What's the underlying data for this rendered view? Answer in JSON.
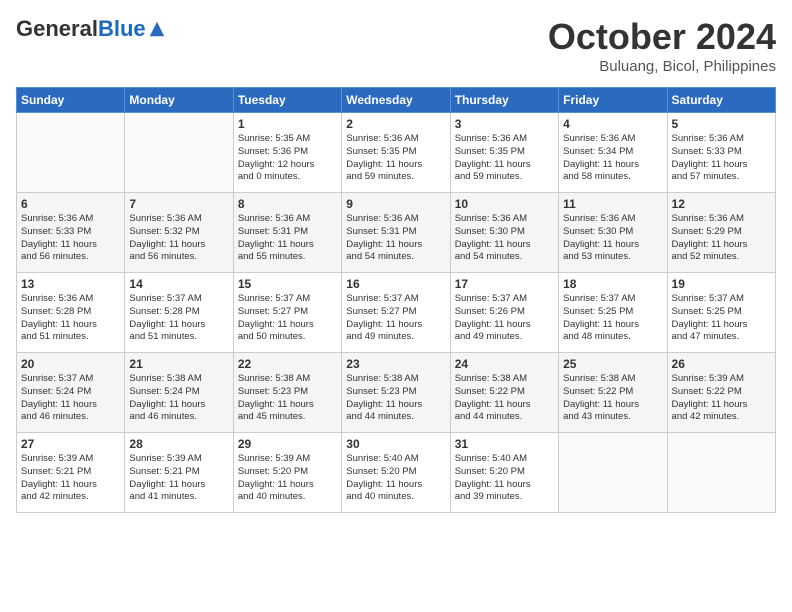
{
  "header": {
    "logo_general": "General",
    "logo_blue": "Blue",
    "month_title": "October 2024",
    "subtitle": "Buluang, Bicol, Philippines"
  },
  "days_of_week": [
    "Sunday",
    "Monday",
    "Tuesday",
    "Wednesday",
    "Thursday",
    "Friday",
    "Saturday"
  ],
  "weeks": [
    [
      {
        "day": "",
        "info": ""
      },
      {
        "day": "",
        "info": ""
      },
      {
        "day": "1",
        "info": "Sunrise: 5:35 AM\nSunset: 5:36 PM\nDaylight: 12 hours\nand 0 minutes."
      },
      {
        "day": "2",
        "info": "Sunrise: 5:36 AM\nSunset: 5:35 PM\nDaylight: 11 hours\nand 59 minutes."
      },
      {
        "day": "3",
        "info": "Sunrise: 5:36 AM\nSunset: 5:35 PM\nDaylight: 11 hours\nand 59 minutes."
      },
      {
        "day": "4",
        "info": "Sunrise: 5:36 AM\nSunset: 5:34 PM\nDaylight: 11 hours\nand 58 minutes."
      },
      {
        "day": "5",
        "info": "Sunrise: 5:36 AM\nSunset: 5:33 PM\nDaylight: 11 hours\nand 57 minutes."
      }
    ],
    [
      {
        "day": "6",
        "info": "Sunrise: 5:36 AM\nSunset: 5:33 PM\nDaylight: 11 hours\nand 56 minutes."
      },
      {
        "day": "7",
        "info": "Sunrise: 5:36 AM\nSunset: 5:32 PM\nDaylight: 11 hours\nand 56 minutes."
      },
      {
        "day": "8",
        "info": "Sunrise: 5:36 AM\nSunset: 5:31 PM\nDaylight: 11 hours\nand 55 minutes."
      },
      {
        "day": "9",
        "info": "Sunrise: 5:36 AM\nSunset: 5:31 PM\nDaylight: 11 hours\nand 54 minutes."
      },
      {
        "day": "10",
        "info": "Sunrise: 5:36 AM\nSunset: 5:30 PM\nDaylight: 11 hours\nand 54 minutes."
      },
      {
        "day": "11",
        "info": "Sunrise: 5:36 AM\nSunset: 5:30 PM\nDaylight: 11 hours\nand 53 minutes."
      },
      {
        "day": "12",
        "info": "Sunrise: 5:36 AM\nSunset: 5:29 PM\nDaylight: 11 hours\nand 52 minutes."
      }
    ],
    [
      {
        "day": "13",
        "info": "Sunrise: 5:36 AM\nSunset: 5:28 PM\nDaylight: 11 hours\nand 51 minutes."
      },
      {
        "day": "14",
        "info": "Sunrise: 5:37 AM\nSunset: 5:28 PM\nDaylight: 11 hours\nand 51 minutes."
      },
      {
        "day": "15",
        "info": "Sunrise: 5:37 AM\nSunset: 5:27 PM\nDaylight: 11 hours\nand 50 minutes."
      },
      {
        "day": "16",
        "info": "Sunrise: 5:37 AM\nSunset: 5:27 PM\nDaylight: 11 hours\nand 49 minutes."
      },
      {
        "day": "17",
        "info": "Sunrise: 5:37 AM\nSunset: 5:26 PM\nDaylight: 11 hours\nand 49 minutes."
      },
      {
        "day": "18",
        "info": "Sunrise: 5:37 AM\nSunset: 5:25 PM\nDaylight: 11 hours\nand 48 minutes."
      },
      {
        "day": "19",
        "info": "Sunrise: 5:37 AM\nSunset: 5:25 PM\nDaylight: 11 hours\nand 47 minutes."
      }
    ],
    [
      {
        "day": "20",
        "info": "Sunrise: 5:37 AM\nSunset: 5:24 PM\nDaylight: 11 hours\nand 46 minutes."
      },
      {
        "day": "21",
        "info": "Sunrise: 5:38 AM\nSunset: 5:24 PM\nDaylight: 11 hours\nand 46 minutes."
      },
      {
        "day": "22",
        "info": "Sunrise: 5:38 AM\nSunset: 5:23 PM\nDaylight: 11 hours\nand 45 minutes."
      },
      {
        "day": "23",
        "info": "Sunrise: 5:38 AM\nSunset: 5:23 PM\nDaylight: 11 hours\nand 44 minutes."
      },
      {
        "day": "24",
        "info": "Sunrise: 5:38 AM\nSunset: 5:22 PM\nDaylight: 11 hours\nand 44 minutes."
      },
      {
        "day": "25",
        "info": "Sunrise: 5:38 AM\nSunset: 5:22 PM\nDaylight: 11 hours\nand 43 minutes."
      },
      {
        "day": "26",
        "info": "Sunrise: 5:39 AM\nSunset: 5:22 PM\nDaylight: 11 hours\nand 42 minutes."
      }
    ],
    [
      {
        "day": "27",
        "info": "Sunrise: 5:39 AM\nSunset: 5:21 PM\nDaylight: 11 hours\nand 42 minutes."
      },
      {
        "day": "28",
        "info": "Sunrise: 5:39 AM\nSunset: 5:21 PM\nDaylight: 11 hours\nand 41 minutes."
      },
      {
        "day": "29",
        "info": "Sunrise: 5:39 AM\nSunset: 5:20 PM\nDaylight: 11 hours\nand 40 minutes."
      },
      {
        "day": "30",
        "info": "Sunrise: 5:40 AM\nSunset: 5:20 PM\nDaylight: 11 hours\nand 40 minutes."
      },
      {
        "day": "31",
        "info": "Sunrise: 5:40 AM\nSunset: 5:20 PM\nDaylight: 11 hours\nand 39 minutes."
      },
      {
        "day": "",
        "info": ""
      },
      {
        "day": "",
        "info": ""
      }
    ]
  ]
}
